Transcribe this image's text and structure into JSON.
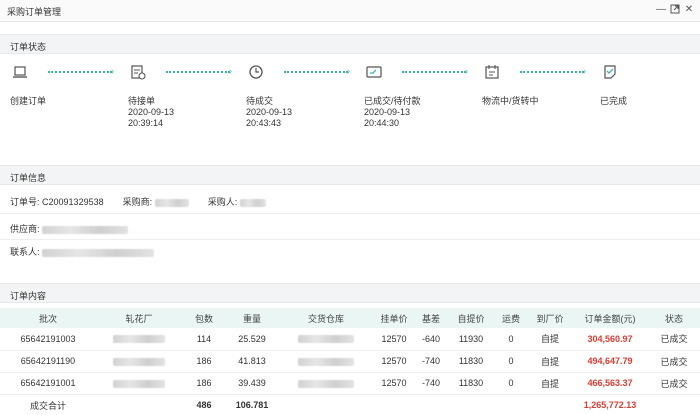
{
  "window": {
    "title": "采购订单管理",
    "controls": [
      "minimize-icon",
      "maximize-icon",
      "close-icon"
    ]
  },
  "status": {
    "section_title": "订单状态",
    "steps": [
      {
        "label": "创建订单",
        "date": "",
        "time": "",
        "icon": "laptop-icon"
      },
      {
        "label": "待接单",
        "date": "2020-09-13",
        "time": "20:39:14",
        "icon": "order-clock-icon"
      },
      {
        "label": "待成交",
        "date": "2020-09-13",
        "time": "20:43:43",
        "icon": "clock-icon"
      },
      {
        "label": "已成交/待付款",
        "date": "2020-09-13",
        "time": "20:44:30",
        "icon": "card-payment-icon"
      },
      {
        "label": "物流中/货转中",
        "date": "",
        "time": "",
        "icon": "calendar-icon"
      },
      {
        "label": "已完成",
        "date": "",
        "time": "",
        "icon": "checklist-icon"
      }
    ],
    "accent": "#3ab6b0"
  },
  "info": {
    "section_title": "订单信息",
    "order_no_label": "订单号:",
    "order_no": "C20091329538",
    "buyer_label": "采购商:",
    "purchaser_label": "采购人:",
    "supplier_label": "供应商:",
    "contact_label": "联系人:"
  },
  "content": {
    "section_title": "订单内容",
    "columns": [
      "批次",
      "轧花厂",
      "包数",
      "重量",
      "交货仓库",
      "挂单价",
      "基差",
      "自提价",
      "运费",
      "到厂价",
      "订单金额(元)",
      "状态"
    ],
    "rows": [
      {
        "batch": "65642191003",
        "packages": "114",
        "weight": "25.529",
        "list_price": "12570",
        "basis": "-640",
        "pickup_price": "11930",
        "freight": "0",
        "factory_price": "自提",
        "amount": "304,560.97",
        "status": "已成交"
      },
      {
        "batch": "65642191190",
        "packages": "186",
        "weight": "41.813",
        "list_price": "12570",
        "basis": "-740",
        "pickup_price": "11830",
        "freight": "0",
        "factory_price": "自提",
        "amount": "494,647.79",
        "status": "已成交"
      },
      {
        "batch": "65642191001",
        "packages": "186",
        "weight": "39.439",
        "list_price": "12570",
        "basis": "-740",
        "pickup_price": "11830",
        "freight": "0",
        "factory_price": "自提",
        "amount": "466,563.37",
        "status": "已成交"
      }
    ],
    "total": {
      "label": "成交合计",
      "packages": "486",
      "weight": "106.781",
      "amount": "1,265,772.13"
    },
    "amount_color": "#e03a2f"
  }
}
